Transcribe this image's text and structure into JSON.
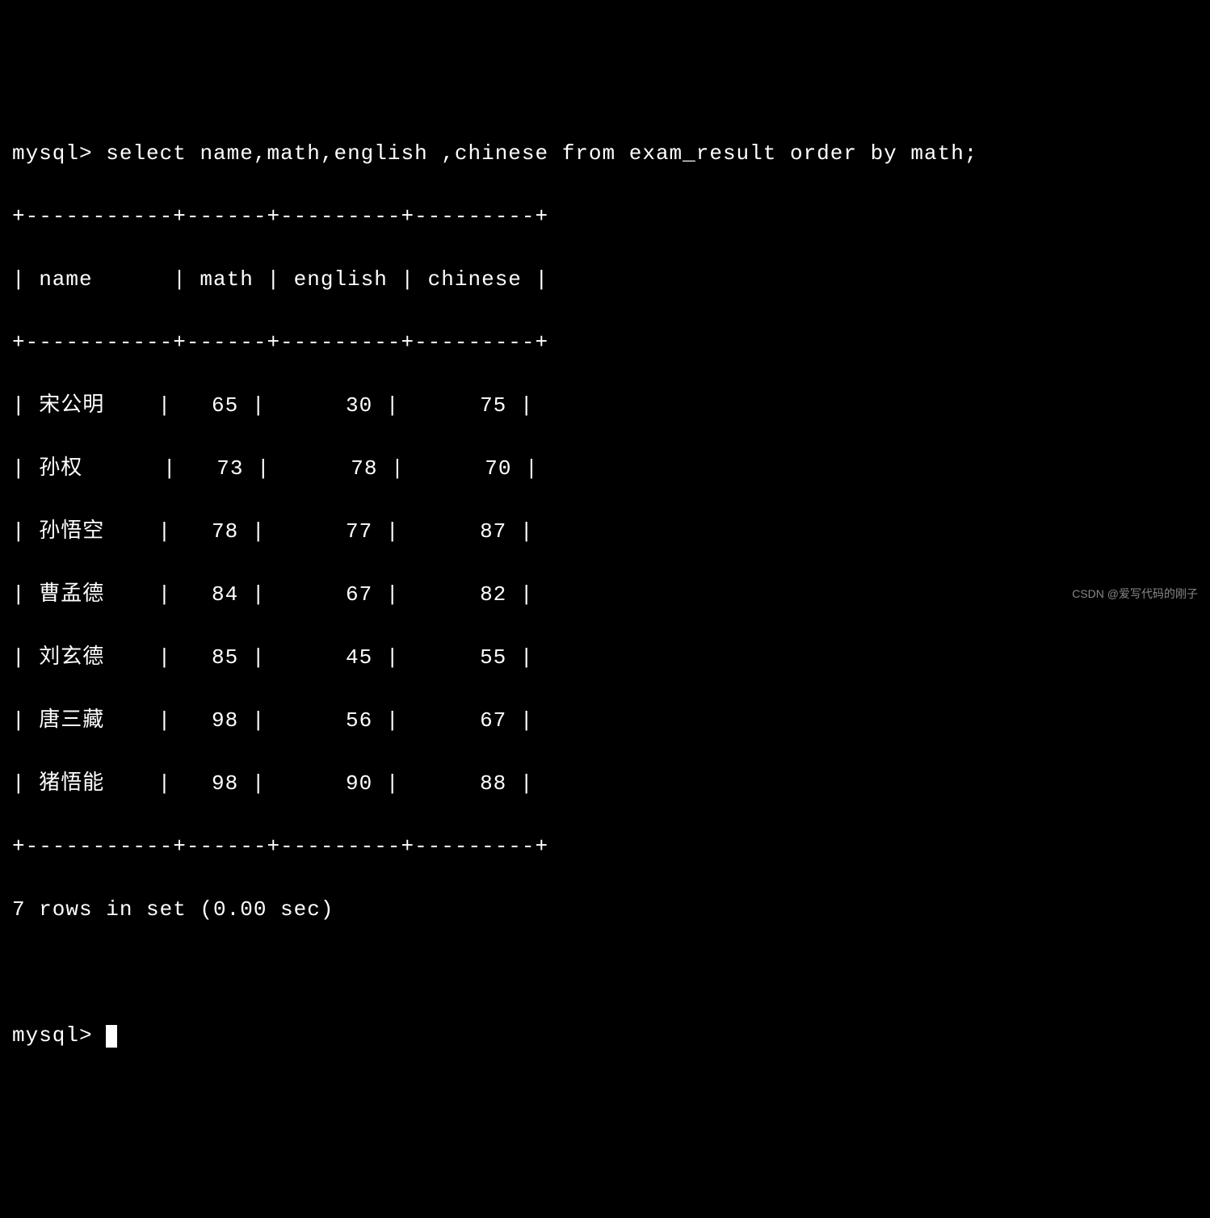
{
  "prompt": "mysql>",
  "query": "select name,math,english ,chinese from exam_result order by math;",
  "divider": "+-----------+------+---------+---------+",
  "header_row": "| name      | math | english | chinese |",
  "chart_data": {
    "type": "table",
    "columns": [
      "name",
      "math",
      "english",
      "chinese"
    ],
    "rows": [
      {
        "name": "宋公明",
        "math": 65,
        "english": 30,
        "chinese": 75
      },
      {
        "name": "孙权",
        "math": 73,
        "english": 78,
        "chinese": 70
      },
      {
        "name": "孙悟空",
        "math": 78,
        "english": 77,
        "chinese": 87
      },
      {
        "name": "曹孟德",
        "math": 84,
        "english": 67,
        "chinese": 82
      },
      {
        "name": "刘玄德",
        "math": 85,
        "english": 45,
        "chinese": 55
      },
      {
        "name": "唐三藏",
        "math": 98,
        "english": 56,
        "chinese": 67
      },
      {
        "name": "猪悟能",
        "math": 98,
        "english": 90,
        "chinese": 88
      }
    ]
  },
  "data_rows_formatted": [
    "| 宋公明    |   65 |      30 |      75 |",
    "| 孙权      |   73 |      78 |      70 |",
    "| 孙悟空    |   78 |      77 |      87 |",
    "| 曹孟德    |   84 |      67 |      82 |",
    "| 刘玄德    |   85 |      45 |      55 |",
    "| 唐三藏    |   98 |      56 |      67 |",
    "| 猪悟能    |   98 |      90 |      88 |"
  ],
  "result_summary": "7 rows in set (0.00 sec)",
  "watermark": "CSDN @爱写代码的刚子"
}
